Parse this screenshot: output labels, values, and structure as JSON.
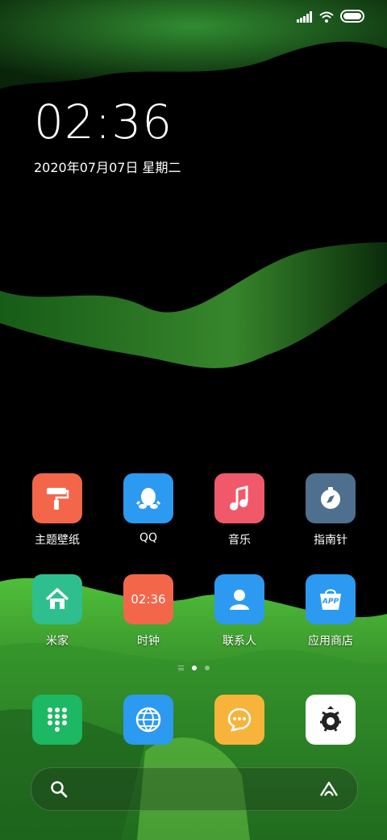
{
  "status_bar": {
    "signal_icon": "signal-icon",
    "wifi_icon": "wifi-icon",
    "battery_icon": "battery-icon"
  },
  "lock_widget": {
    "time": "02:36",
    "date": "2020年07月07日 星期二"
  },
  "apps_row1": [
    {
      "label": "主题壁纸",
      "icon": "paint-roller-icon",
      "color": "#F4664A"
    },
    {
      "label": "QQ",
      "icon": "qq-penguin-icon",
      "color": "#2C9AF0"
    },
    {
      "label": "音乐",
      "icon": "music-note-icon",
      "color": "#F0596A"
    },
    {
      "label": "指南针",
      "icon": "compass-icon",
      "color": "#4F6F8E"
    }
  ],
  "apps_row2": [
    {
      "label": "米家",
      "icon": "home-icon",
      "color": "#2FBF8E"
    },
    {
      "label": "时钟",
      "icon": "clock-icon",
      "icon_text": "02:36",
      "color": "#F4664A"
    },
    {
      "label": "联系人",
      "icon": "contact-person-icon",
      "color": "#2C9AF0"
    },
    {
      "label": "应用商店",
      "icon": "app-store-bag-icon",
      "icon_text": "APP",
      "color": "#2C9AF0"
    }
  ],
  "dock": [
    {
      "icon": "dialer-keypad-icon",
      "color": "#1DB863"
    },
    {
      "icon": "browser-globe-icon",
      "color": "#2C9AF0"
    },
    {
      "icon": "messages-bubble-icon",
      "color": "#F8B33A"
    },
    {
      "icon": "settings-gear-icon",
      "color": "#FFFFFF"
    }
  ],
  "page_indicator": {
    "pages": 2,
    "current": 1
  },
  "search_bar": {
    "left_icon": "search-icon",
    "right_icon": "assistant-icon"
  }
}
